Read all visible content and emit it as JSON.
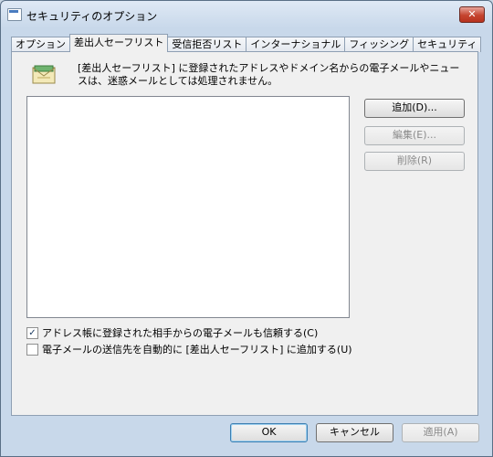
{
  "window": {
    "title": "セキュリティのオプション",
    "close_glyph": "✕"
  },
  "tabs": [
    {
      "label": "オプション",
      "active": false
    },
    {
      "label": "差出人セーフリスト",
      "active": true
    },
    {
      "label": "受信拒否リスト",
      "active": false
    },
    {
      "label": "インターナショナル",
      "active": false
    },
    {
      "label": "フィッシング",
      "active": false
    },
    {
      "label": "セキュリティ",
      "active": false
    }
  ],
  "panel": {
    "description": "[差出人セーフリスト] に登録されたアドレスやドメイン名からの電子メールやニュースは、迷惑メールとしては処理されません。",
    "buttons": {
      "add": "追加(D)...",
      "edit": "編集(E)...",
      "delete": "削除(R)"
    },
    "checkboxes": {
      "trust_address_book": {
        "label": "アドレス帳に登録された相手からの電子メールも信頼する(C)",
        "checked": true
      },
      "auto_add_recipients": {
        "label": "電子メールの送信先を自動的に [差出人セーフリスト] に追加する(U)",
        "checked": false
      }
    }
  },
  "footer": {
    "ok": "OK",
    "cancel": "キャンセル",
    "apply": "適用(A)"
  },
  "colors": {
    "accent": "#3c7fb1",
    "close": "#c5442f"
  }
}
